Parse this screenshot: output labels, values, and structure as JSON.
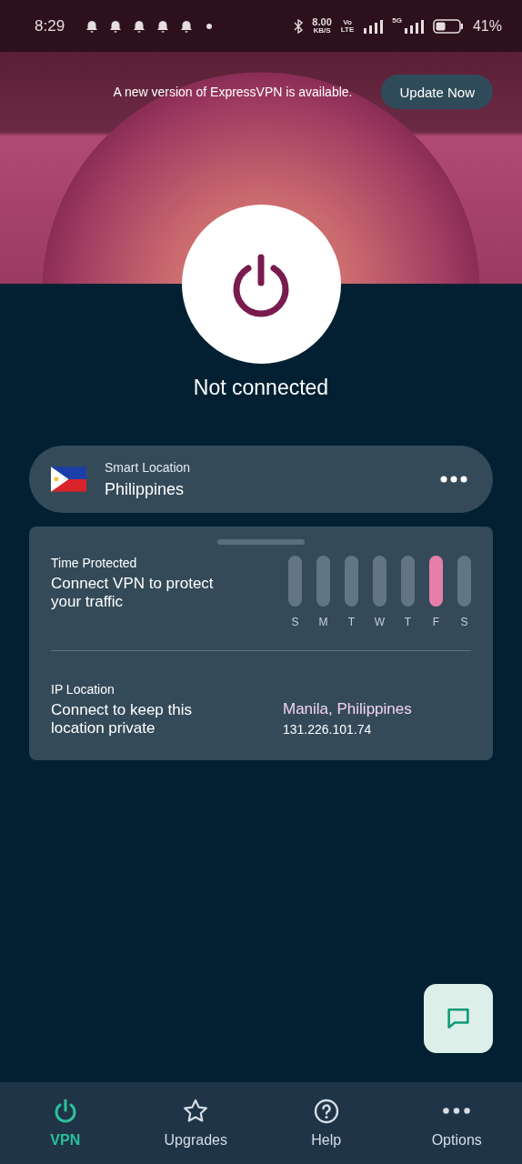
{
  "status_bar": {
    "time": "8:29",
    "speed": "8.00",
    "speed_unit": "KB/S",
    "volte_top": "Vo",
    "volte_bottom": "LTE",
    "network": "5G",
    "battery": "41%"
  },
  "banner": {
    "message": "A new version of ExpressVPN is available.",
    "button": "Update Now"
  },
  "connection": {
    "connected": false,
    "status": "Not connected"
  },
  "location": {
    "label": "Smart Location",
    "name": "Philippines"
  },
  "time_protected": {
    "title": "Time Protected",
    "message": "Connect VPN to protect your traffic",
    "days": [
      {
        "label": "S",
        "selected": false
      },
      {
        "label": "M",
        "selected": false
      },
      {
        "label": "T",
        "selected": false
      },
      {
        "label": "W",
        "selected": false
      },
      {
        "label": "T",
        "selected": false
      },
      {
        "label": "F",
        "selected": true
      },
      {
        "label": "S",
        "selected": false
      }
    ]
  },
  "ip_location": {
    "title": "IP Location",
    "message": "Connect to keep this location private",
    "place": "Manila, Philippines",
    "ip": "131.226.101.74"
  },
  "nav": [
    {
      "kind": "power",
      "label": "VPN",
      "selected": true
    },
    {
      "kind": "star",
      "label": "Upgrades",
      "selected": false
    },
    {
      "kind": "help",
      "label": "Help",
      "selected": false
    },
    {
      "kind": "more",
      "label": "Options",
      "selected": false
    }
  ]
}
